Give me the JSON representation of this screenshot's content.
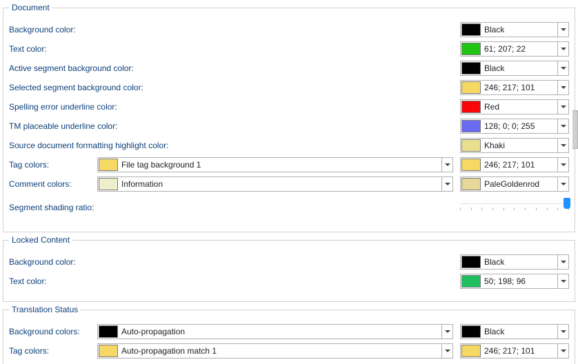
{
  "groups": {
    "document": {
      "legend": "Document",
      "rows": {
        "bg": {
          "label": "Background color:",
          "swatch": "#000000",
          "value": "Black"
        },
        "text": {
          "label": "Text color:",
          "swatch": "#22c516",
          "value": "61; 207; 22"
        },
        "active_bg": {
          "label": "Active segment background color:",
          "swatch": "#000000",
          "value": "Black"
        },
        "selected_bg": {
          "label": "Selected segment background color:",
          "swatch": "#f6d965",
          "value": "246; 217; 101"
        },
        "spell_err": {
          "label": "Spelling error underline color:",
          "swatch": "#f90808",
          "value": "Red"
        },
        "tm_place": {
          "label": "TM placeable underline color:",
          "swatch": "#6a6af0",
          "value": "128; 0; 0; 255"
        },
        "src_fmt": {
          "label": "Source document formatting highlight color:",
          "swatch": "#e9df8e",
          "value": "Khaki"
        },
        "tag_colors": {
          "label": "Tag colors:",
          "combo_swatch": "#f6d965",
          "combo_text": "File tag background 1",
          "swatch": "#f6d965",
          "value": "246; 217; 101"
        },
        "comment_col": {
          "label": "Comment colors:",
          "combo_swatch": "#eeeecb",
          "combo_text": "Information",
          "swatch": "#e6d999",
          "value": "PaleGoldenrod"
        },
        "seg_shade": {
          "label": "Segment shading ratio:"
        }
      }
    },
    "locked": {
      "legend": "Locked Content",
      "rows": {
        "bg": {
          "label": "Background color:",
          "swatch": "#000000",
          "value": "Black"
        },
        "text": {
          "label": "Text color:",
          "swatch": "#1fbf60",
          "value": "50; 198; 96"
        }
      }
    },
    "trans_status": {
      "legend": "Translation Status",
      "rows": {
        "bg_colors": {
          "label": "Background colors:",
          "combo_swatch": "#000000",
          "combo_text": "Auto-propagation",
          "swatch": "#000000",
          "value": "Black"
        },
        "tag_colors": {
          "label": "Tag colors:",
          "combo_swatch": "#f6d965",
          "combo_text": "Auto-propagation match 1",
          "swatch": "#f6d965",
          "value": "246; 217; 101"
        }
      }
    }
  }
}
